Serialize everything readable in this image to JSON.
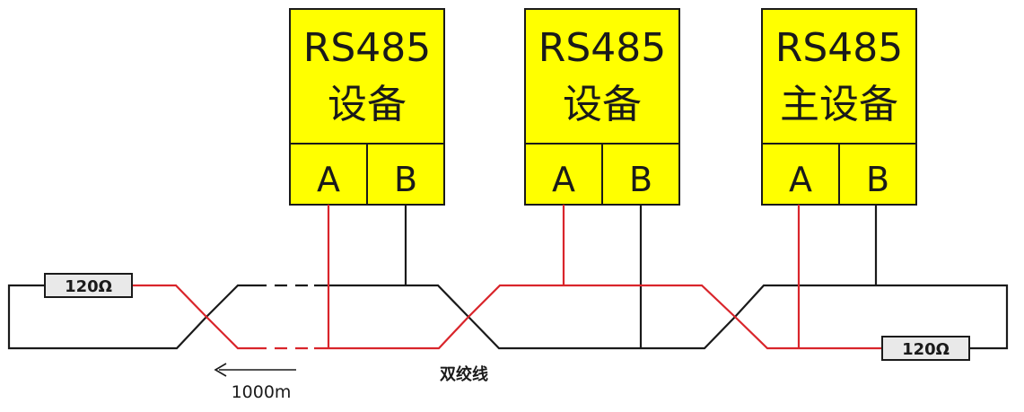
{
  "colors": {
    "device_fill": "#ffff00",
    "wire_a": "#d9252b",
    "wire_b": "#1a1a1a",
    "resistor_fill": "#e9e9e9"
  },
  "devices": [
    {
      "title_line1": "RS485",
      "title_line2": "设备",
      "pin_a": "A",
      "pin_b": "B"
    },
    {
      "title_line1": "RS485",
      "title_line2": "设备",
      "pin_a": "A",
      "pin_b": "B"
    },
    {
      "title_line1": "RS485",
      "title_line2": "主设备",
      "pin_a": "A",
      "pin_b": "B"
    }
  ],
  "resistors": {
    "left": "120Ω",
    "right": "120Ω"
  },
  "cable_label": "双绞线",
  "distance": {
    "label": "1000m",
    "arrow_icon": "arrow-left-icon"
  }
}
